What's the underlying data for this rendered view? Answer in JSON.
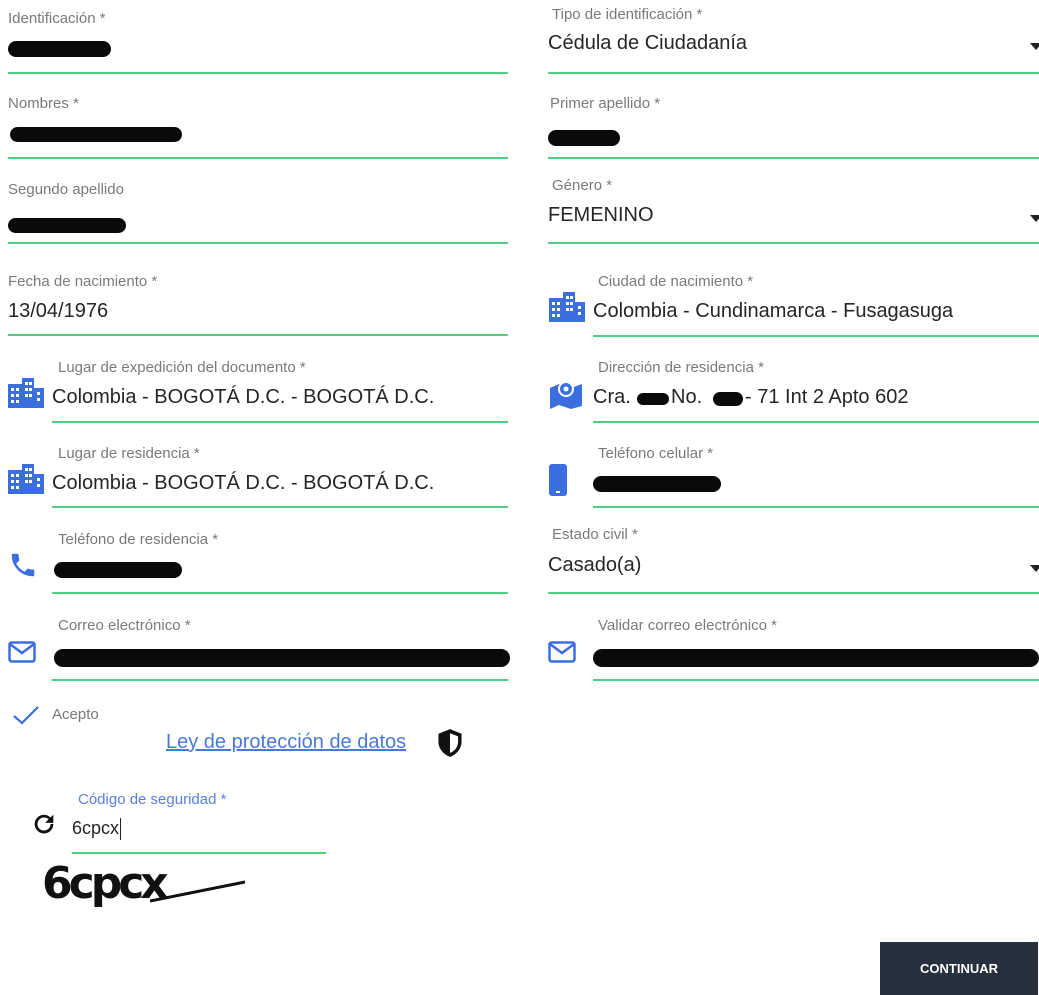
{
  "left": {
    "identificacion": {
      "label": "Identificación *"
    },
    "nombres": {
      "label": "Nombres *"
    },
    "segundo_apellido": {
      "label": "Segundo apellido"
    },
    "fecha": {
      "label": "Fecha de nacimiento *",
      "value": "13/04/1976"
    },
    "lugar_expedicion": {
      "label": "Lugar de expedición del documento *",
      "value": "Colombia - BOGOTÁ D.C. - BOGOTÁ D.C."
    },
    "lugar_residencia": {
      "label": "Lugar de residencia *",
      "value": "Colombia - BOGOTÁ D.C. - BOGOTÁ D.C."
    },
    "telefono_residencia": {
      "label": "Teléfono de residencia *"
    },
    "correo": {
      "label": "Correo electrónico *"
    }
  },
  "right": {
    "tipo_id": {
      "label": "Tipo de identificación *",
      "value": "Cédula de Ciudadanía"
    },
    "primer_apellido": {
      "label": "Primer apellido *"
    },
    "genero": {
      "label": "Género *",
      "value": "FEMENINO"
    },
    "ciudad_nacimiento": {
      "label": "Ciudad de nacimiento *",
      "value": "Colombia - Cundinamarca - Fusagasuga"
    },
    "direccion": {
      "label": "Dirección de residencia *",
      "value_a": "Cra.",
      "value_b": "No.",
      "value_c": "- 71 Int 2 Apto 602"
    },
    "celular": {
      "label": "Teléfono celular *"
    },
    "estado_civil": {
      "label": "Estado civil *",
      "value": "Casado(a)"
    },
    "validar_correo": {
      "label": "Validar correo electrónico *"
    }
  },
  "accept": {
    "label": "Acepto",
    "link": "Ley de protección de datos"
  },
  "security": {
    "label": "Código de seguridad *",
    "value": "6cpcx",
    "captcha_text": "6cpcx"
  },
  "button": {
    "label": "CONTINUAR"
  },
  "colors": {
    "accent_line": "#4cd07d",
    "icon_blue": "#3b6fe0",
    "button_bg": "#26313d"
  }
}
